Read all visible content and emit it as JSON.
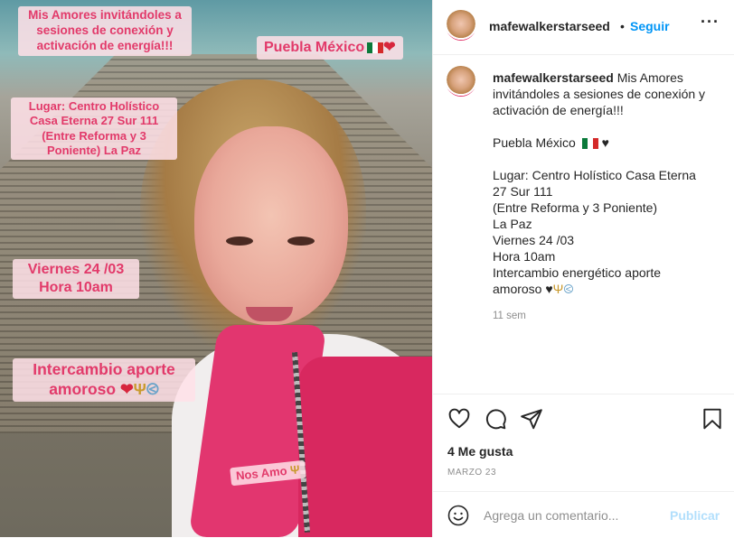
{
  "photo": {
    "invite_text": "Mis Amores invitándoles a sesiones de conexión y activación de energía!!!",
    "place_text": "Puebla México",
    "place_icons": [
      "mexico-flag",
      "red-heart"
    ],
    "address_text": "Lugar: Centro Holístico Casa Eterna 27 Sur 111 (Entre Reforma y 3 Poniente) La Paz",
    "date_line1": "Viernes 24 /03",
    "date_line2": "Hora 10am",
    "exchange_line1": "Intercambio aporte",
    "exchange_line2": "amoroso",
    "exchange_icons": [
      "red-heart",
      "trident",
      "shell"
    ],
    "nos_amo": "Nos Amo"
  },
  "header": {
    "username": "mafewalkerstarseed",
    "separator": "•",
    "follow_label": "Seguir",
    "more_label": "···"
  },
  "caption": {
    "username": "mafewalkerstarseed",
    "line1": "Mis Amores invitándoles a sesiones de conexión y activación de energía!!!",
    "place": "Puebla México",
    "place_icons": [
      "mexico-flag",
      "black-heart"
    ],
    "lugar": "Lugar: Centro Holístico Casa Eterna",
    "address": "27 Sur 111",
    "between": "(Entre Reforma y 3 Poniente)",
    "colonia": "La Paz",
    "day": "Viernes 24 /03",
    "hour": "Hora 10am",
    "exchange_a": "Intercambio energético aporte",
    "exchange_b": "amoroso",
    "exchange_icons": [
      "black-heart",
      "trident",
      "shell"
    ],
    "time_ago": "11 sem"
  },
  "actions": {
    "icons": [
      "heart-icon",
      "comment-icon",
      "share-icon",
      "bookmark-icon"
    ],
    "likes": "4 Me gusta",
    "date": "MARZO 23"
  },
  "comment": {
    "placeholder": "Agrega un comentario...",
    "publish_label": "Publicar"
  },
  "colors": {
    "link_blue": "#0095f6",
    "publish_disabled": "#b2dffc",
    "overlay_pink_text": "#e23a6a"
  }
}
